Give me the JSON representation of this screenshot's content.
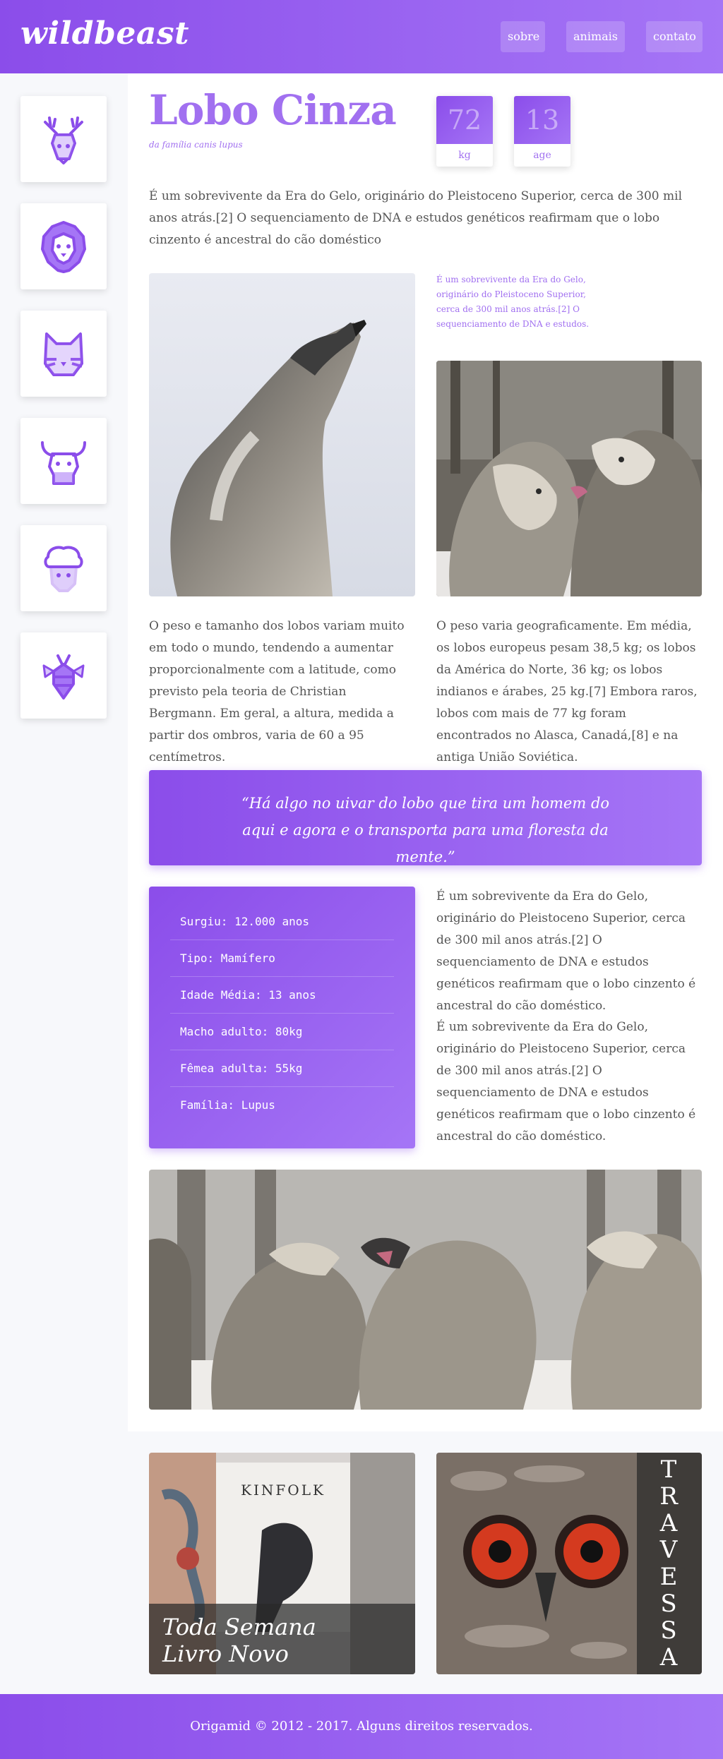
{
  "header": {
    "logo": "wildbeast",
    "nav": [
      "sobre",
      "animais",
      "contato"
    ]
  },
  "sidebar": {
    "icons": [
      "deer-icon",
      "lion-icon",
      "cat-icon",
      "bull-icon",
      "sheep-icon",
      "bee-icon"
    ]
  },
  "animal": {
    "name": "Lobo Cinza",
    "family": "da família canis lupus",
    "stats": [
      {
        "value": "72",
        "unit": "kg"
      },
      {
        "value": "13",
        "unit": "age"
      }
    ],
    "intro": "É um sobrevivente da Era do Gelo, originário do Pleistoceno Superior, cerca de 300 mil anos atrás.[2] O sequenciamento de DNA e estudos genéticos reafirmam que o lobo cinzento é ancestral do cão doméstico",
    "side_caption": "É um sobrevivente da Era do Gelo, originário do Pleistoceno Superior, cerca de 300 mil anos atrás.[2] O sequenciamento de DNA e estudos.",
    "para_left": "O peso e tamanho dos lobos variam muito em todo o mundo, tendendo a aumentar proporcionalmente com a latitude, como previsto pela teoria de Christian Bergmann. Em geral, a altura, medida a partir dos ombros, varia de 60 a 95 centímetros.",
    "para_right": "O peso varia geograficamente. Em média, os lobos europeus pesam 38,5 kg; os lobos da América do Norte, 36 kg; os lobos indianos e árabes, 25 kg.[7] Embora raros, lobos com mais de 77 kg foram encontrados no Alasca, Canadá,[8] e na antiga União Soviética.",
    "quote": "“Há algo no uivar do lobo que tira um homem do aqui e agora e o transporta para uma floresta da mente.”",
    "facts": [
      "Surgiu: 12.000 anos",
      "Tipo: Mamífero",
      "Idade Média: 13 anos",
      "Macho adulto: 80kg",
      "Fêmea adulta: 55kg",
      "Família: Lupus"
    ],
    "facts_text_1": "É um sobrevivente da Era do Gelo, originário do Pleistoceno Superior, cerca de 300 mil anos atrás.[2] O sequenciamento de DNA e estudos genéticos reafirmam que o lobo cinzento é ancestral do cão doméstico.",
    "facts_text_2": "É um sobrevivente da Era do Gelo, originário do Pleistoceno Superior, cerca de 300 mil anos atrás.[2] O sequenciamento de DNA e estudos genéticos reafirmam que o lobo cinzento é ancestral do cão doméstico."
  },
  "promo": {
    "book_brand": "KINFOLK",
    "book_caption_line1": "Toda Semana",
    "book_caption_line2": "Livro Novo",
    "owl_word": "TRAVESSA"
  },
  "footer": {
    "text": "Origamid © 2012 - 2017. Alguns direitos reservados."
  }
}
